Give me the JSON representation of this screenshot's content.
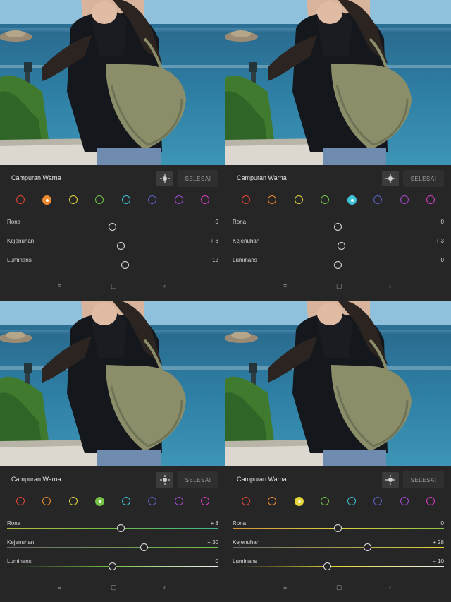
{
  "title": "Campuran Warna",
  "done_label": "SELESAI",
  "target_icon": "target-adjust-icon",
  "nav_icons": [
    "recent-apps-icon",
    "home-icon",
    "back-icon"
  ],
  "nav_glyphs": [
    "≡",
    "▢",
    "‹"
  ],
  "swatch_colors": [
    "#e8463c",
    "#f08a30",
    "#e6d63a",
    "#74c447",
    "#3fc3d6",
    "#5b62c9",
    "#a34bd1",
    "#d63fc5"
  ],
  "swatch_names": [
    "red",
    "orange",
    "yellow",
    "green",
    "aqua",
    "blue",
    "purple",
    "magenta"
  ],
  "panels": [
    {
      "selected": 1,
      "rows": [
        {
          "label": "Rona",
          "value": "0",
          "level": 0
        },
        {
          "label": "Kejenuhan",
          "value": "+ 8",
          "level": 8
        },
        {
          "label": "Luminans",
          "value": "+ 12",
          "level": 12
        }
      ]
    },
    {
      "selected": 4,
      "rows": [
        {
          "label": "Rona",
          "value": "0",
          "level": 0
        },
        {
          "label": "Kejenuhan",
          "value": "+ 3",
          "level": 3
        },
        {
          "label": "Luminans",
          "value": "0",
          "level": 0
        }
      ]
    },
    {
      "selected": 3,
      "rows": [
        {
          "label": "Rona",
          "value": "+ 8",
          "level": 8
        },
        {
          "label": "Kejenuhan",
          "value": "+ 30",
          "level": 30
        },
        {
          "label": "Luminans",
          "value": "0",
          "level": 0
        }
      ]
    },
    {
      "selected": 2,
      "rows": [
        {
          "label": "Rona",
          "value": "0",
          "level": 0
        },
        {
          "label": "Kejenuhan",
          "value": "+ 28",
          "level": 28
        },
        {
          "label": "Luminans",
          "value": "− 10",
          "level": -10
        }
      ]
    }
  ]
}
